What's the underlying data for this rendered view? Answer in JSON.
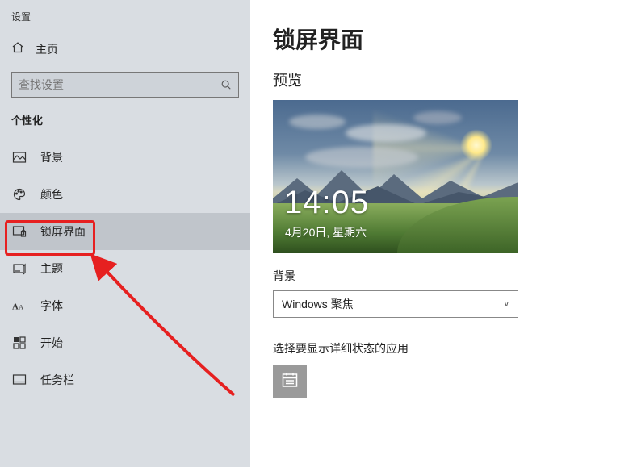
{
  "window_title": "设置",
  "home_label": "主页",
  "search": {
    "placeholder": "查找设置"
  },
  "section_label": "个性化",
  "nav": {
    "background": "背景",
    "colors": "颜色",
    "lockscreen": "锁屏界面",
    "themes": "主题",
    "fonts": "字体",
    "start": "开始",
    "taskbar": "任务栏"
  },
  "main": {
    "heading": "锁屏界面",
    "preview_label": "预览",
    "preview_time": "14:05",
    "preview_date": "4月20日, 星期六",
    "bg_label": "背景",
    "bg_value": "Windows 聚焦",
    "detail_app_label": "选择要显示详细状态的应用"
  }
}
